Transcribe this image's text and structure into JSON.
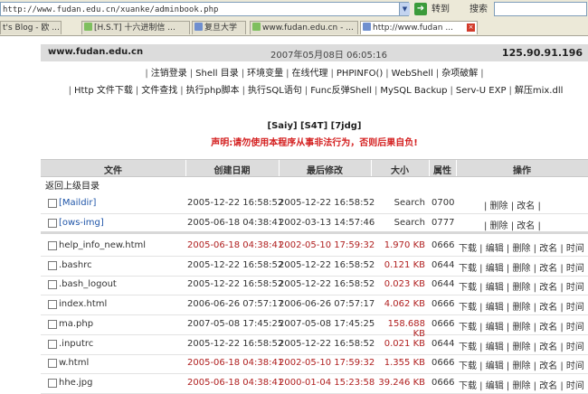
{
  "browser": {
    "url": "http://www.fudan.edu.cn/xuanke/adminbook.php",
    "go_label": "转到",
    "search_label": "搜索",
    "tabs": [
      {
        "label": "t's Blog - 欧 ..."
      },
      {
        "label": "[H.S.T] 十六进制信 ..."
      },
      {
        "label": "复旦大学"
      },
      {
        "label": "www.fudan.edu.cn - ..."
      },
      {
        "label": "http://www.fudan ..."
      }
    ]
  },
  "header": {
    "site": "www.fudan.edu.cn",
    "datetime": "2007年05月08日 06:05:16",
    "ip": "125.90.91.196"
  },
  "menu1": [
    "注销登录",
    "Shell 目录",
    "环境变量",
    "在线代理",
    "PHPINFO()",
    "WebShell",
    "杂项破解"
  ],
  "menu2": [
    "Http 文件下载",
    "文件查找",
    "执行php脚本",
    "执行SQL语句",
    "Func反弹Shell",
    "MySQL Backup",
    "Serv-U EXP",
    "解压mix.dll"
  ],
  "toolbar_links": "[Saiy] [S4T] [7jdg]",
  "warning": "声明:请勿使用本程序从事非法行为，否则后果自负!",
  "table": {
    "headers": [
      "文件",
      "创建日期",
      "最后修改",
      "大小",
      "属性",
      "操作"
    ],
    "up_link": "返回上级目录",
    "dirs": [
      {
        "name": "[Maildir]",
        "created": "2005-12-22 16:58:52",
        "modified": "2005-12-22 16:58:52",
        "size": "Search",
        "perm": "0700",
        "actions": "| 删除 | 改名 |"
      },
      {
        "name": "[ows-img]",
        "created": "2005-06-18 04:38:41",
        "modified": "2002-03-13 14:57:46",
        "size": "Search",
        "perm": "0777",
        "actions": "| 删除 | 改名 |"
      }
    ],
    "files": [
      {
        "name": "help_info_new.html",
        "created": "2005-06-18 04:38:41",
        "modified": "2002-05-10 17:59:32",
        "size": "1.970 KB",
        "perm": "0666",
        "actions": "下载 | 编辑 | 删除 | 改名 | 时间",
        "highlight": true
      },
      {
        "name": ".bashrc",
        "created": "2005-12-22 16:58:52",
        "modified": "2005-12-22 16:58:52",
        "size": "0.121 KB",
        "perm": "0644",
        "actions": "下载 | 编辑 | 删除 | 改名 | 时间",
        "highlight": false
      },
      {
        "name": ".bash_logout",
        "created": "2005-12-22 16:58:52",
        "modified": "2005-12-22 16:58:52",
        "size": "0.023 KB",
        "perm": "0644",
        "actions": "下载 | 编辑 | 删除 | 改名 | 时间",
        "highlight": false
      },
      {
        "name": "index.html",
        "created": "2006-06-26 07:57:17",
        "modified": "2006-06-26 07:57:17",
        "size": "4.062 KB",
        "perm": "0666",
        "actions": "下载 | 编辑 | 删除 | 改名 | 时间",
        "highlight": false
      },
      {
        "name": "ma.php",
        "created": "2007-05-08 17:45:25",
        "modified": "2007-05-08 17:45:25",
        "size": "158.688 KB",
        "perm": "0666",
        "actions": "下载 | 编辑 | 删除 | 改名 | 时间",
        "highlight": false
      },
      {
        "name": ".inputrc",
        "created": "2005-12-22 16:58:52",
        "modified": "2005-12-22 16:58:52",
        "size": "0.021 KB",
        "perm": "0644",
        "actions": "下载 | 编辑 | 删除 | 改名 | 时间",
        "highlight": false
      },
      {
        "name": "w.html",
        "created": "2005-06-18 04:38:41",
        "modified": "2002-05-10 17:59:32",
        "size": "1.355 KB",
        "perm": "0666",
        "actions": "下载 | 编辑 | 删除 | 改名 | 时间",
        "highlight": true
      },
      {
        "name": "hhe.jpg",
        "created": "2005-06-18 04:38:41",
        "modified": "2000-01-04 15:23:58",
        "size": "39.246 KB",
        "perm": "0666",
        "actions": "下载 | 编辑 | 删除 | 改名 | 时间",
        "highlight": true
      }
    ]
  },
  "colors": {
    "highlight_text": "#b02020",
    "dir_link": "#1f55a8",
    "warning": "#d42020",
    "header_bg": "#dcdcdc"
  }
}
